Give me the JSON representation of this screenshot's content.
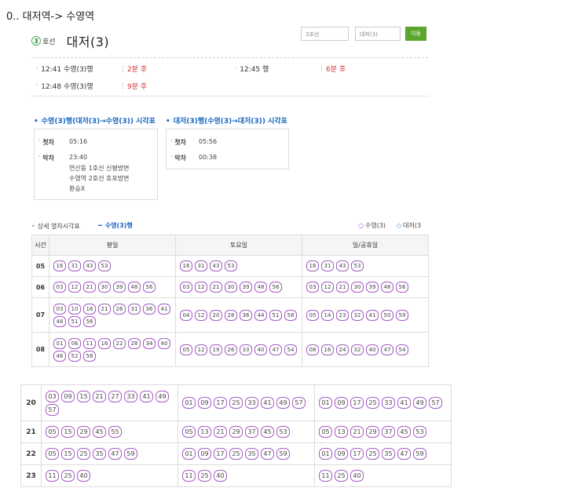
{
  "page_title": "0.. 대저역-> 수영역",
  "line": {
    "badge": "3",
    "name": "호선"
  },
  "station": "대저(3)",
  "search": {
    "line_placeholder": "3호선",
    "station_placeholder": "대저(3)",
    "go_label": "이동"
  },
  "arrivals": [
    {
      "dest": "12:41 수영(3)행",
      "eta": "2분 후"
    },
    {
      "dest": "12:45 행",
      "eta": "6분 후"
    },
    {
      "dest": "12:48 수영(3)행",
      "eta": "9분 후"
    }
  ],
  "timetable_left": {
    "title": "수영(3)행(대저(3)→수영(3)) 시각표",
    "first_label": "첫차",
    "first_time": "05:16",
    "last_label": "막차",
    "last_time": "23:40",
    "notes": [
      "연산동 1호선 신평방면",
      "수영역 2호선 호포방면",
      "환승X"
    ]
  },
  "timetable_right": {
    "title": "대저(3)행(수영(3)→대저(3)) 시각표",
    "first_label": "첫차",
    "first_time": "05:56",
    "last_label": "막차",
    "last_time": "00:38"
  },
  "detail": {
    "label": "상세 열차시각표",
    "direction": "수영(3)행",
    "legend_a": "수영(3)",
    "legend_b": "대저(3",
    "headers": [
      "시간",
      "평일",
      "토요일",
      "일/공휴일"
    ]
  },
  "schedule_top": [
    {
      "hour": "05",
      "weekday": [
        "16",
        "31",
        "43",
        "53"
      ],
      "saturday": [
        "16",
        "31",
        "43",
        "53"
      ],
      "holiday": [
        "16",
        "31",
        "43",
        "53"
      ]
    },
    {
      "hour": "06",
      "weekday": [
        "03",
        "12",
        "21",
        "30",
        "39",
        "48",
        "56"
      ],
      "saturday": [
        "03",
        "12",
        "21",
        "30",
        "39",
        "48",
        "56"
      ],
      "holiday": [
        "03",
        "12",
        "21",
        "30",
        "39",
        "48",
        "56"
      ]
    },
    {
      "hour": "07",
      "weekday": [
        "03",
        "10",
        "16",
        "21",
        "26",
        "31",
        "36",
        "41",
        "46",
        "51",
        "56"
      ],
      "saturday": [
        "04",
        "12",
        "20",
        "28",
        "36",
        "44",
        "51",
        "58"
      ],
      "holiday": [
        "05",
        "14",
        "23",
        "32",
        "41",
        "50",
        "59"
      ]
    },
    {
      "hour": "08",
      "weekday": [
        "01",
        "06",
        "11",
        "16",
        "22",
        "28",
        "34",
        "40",
        "46",
        "52",
        "58"
      ],
      "saturday": [
        "05",
        "12",
        "19",
        "26",
        "33",
        "40",
        "47",
        "54"
      ],
      "holiday": [
        "08",
        "16",
        "24",
        "32",
        "40",
        "47",
        "54"
      ]
    }
  ],
  "schedule_bottom": [
    {
      "hour": "20",
      "weekday": [
        "03",
        "09",
        "15",
        "21",
        "27",
        "33",
        "41",
        "49",
        "57"
      ],
      "saturday": [
        "01",
        "09",
        "17",
        "25",
        "33",
        "41",
        "49",
        "57"
      ],
      "holiday": [
        "01",
        "09",
        "17",
        "25",
        "33",
        "41",
        "49",
        "57"
      ]
    },
    {
      "hour": "21",
      "weekday": [
        "05",
        "15",
        "29",
        "45",
        "55"
      ],
      "saturday": [
        "05",
        "13",
        "21",
        "29",
        "37",
        "45",
        "53"
      ],
      "holiday": [
        "05",
        "13",
        "21",
        "29",
        "37",
        "45",
        "53"
      ]
    },
    {
      "hour": "22",
      "weekday": [
        "05",
        "15",
        "25",
        "35",
        "47",
        "59"
      ],
      "saturday": [
        "01",
        "09",
        "17",
        "25",
        "35",
        "47",
        "59"
      ],
      "holiday": [
        "01",
        "09",
        "17",
        "25",
        "35",
        "47",
        "59"
      ]
    },
    {
      "hour": "23",
      "weekday": [
        "11",
        "25",
        "40"
      ],
      "saturday": [
        "11",
        "25",
        "40"
      ],
      "holiday": [
        "11",
        "25",
        "40"
      ]
    }
  ],
  "colors": {
    "accent_blue": "#1565c0",
    "go_green": "#5aa52c",
    "eta_red": "#d32f2f",
    "minute_border": "#a55bc5",
    "line3": "#4caf50"
  }
}
